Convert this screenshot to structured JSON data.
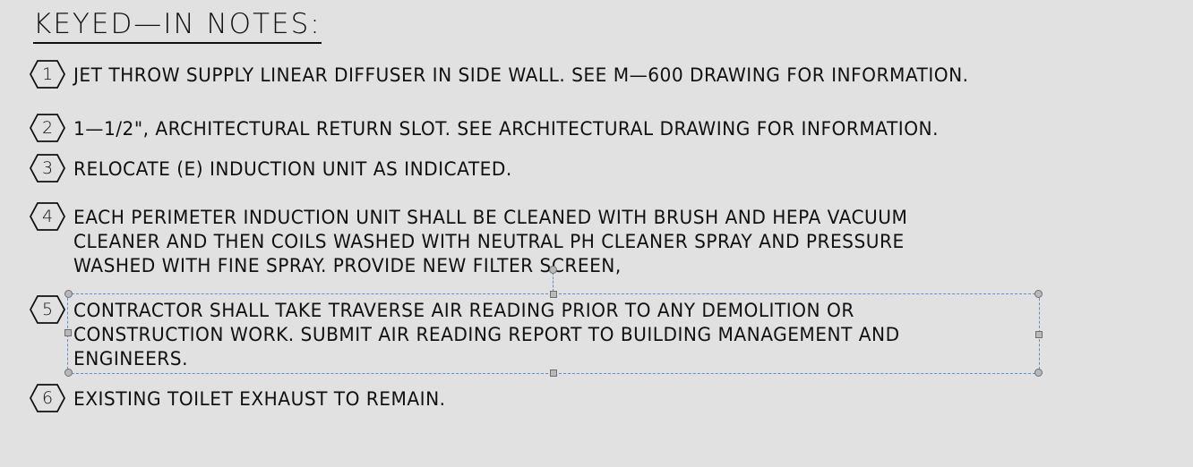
{
  "title": "KEYED—IN NOTES:",
  "notes": [
    {
      "num": "1",
      "lines": [
        "JET THROW SUPPLY LINEAR DIFFUSER IN SIDE WALL. SEE M—600 DRAWING FOR INFORMATION."
      ]
    },
    {
      "num": "2",
      "lines": [
        "1—1/2\", ARCHITECTURAL RETURN SLOT. SEE ARCHITECTURAL DRAWING FOR INFORMATION."
      ]
    },
    {
      "num": "3",
      "lines": [
        "RELOCATE (E) INDUCTION UNIT AS INDICATED."
      ]
    },
    {
      "num": "4",
      "lines": [
        "EACH PERIMETER INDUCTION UNIT SHALL BE CLEANED WITH BRUSH AND HEPA VACUUM",
        "CLEANER AND THEN COILS WASHED WITH NEUTRAL PH CLEANER SPRAY AND PRESSURE",
        "WASHED WITH FINE SPRAY. PROVIDE NEW FILTER SCREEN,"
      ]
    },
    {
      "num": "5",
      "lines": [
        "CONTRACTOR SHALL TAKE TRAVERSE AIR READING PRIOR TO ANY DEMOLITION OR",
        "CONSTRUCTION WORK. SUBMIT AIR READING REPORT TO BUILDING MANAGEMENT AND",
        "ENGINEERS."
      ]
    },
    {
      "num": "6",
      "lines": [
        "EXISTING TOILET EXHAUST TO REMAIN."
      ]
    }
  ],
  "colors": {
    "background": "#e1e1e1",
    "selection": "#5b8fd6",
    "grip": "#b9b9b9"
  },
  "selected_note": "5"
}
